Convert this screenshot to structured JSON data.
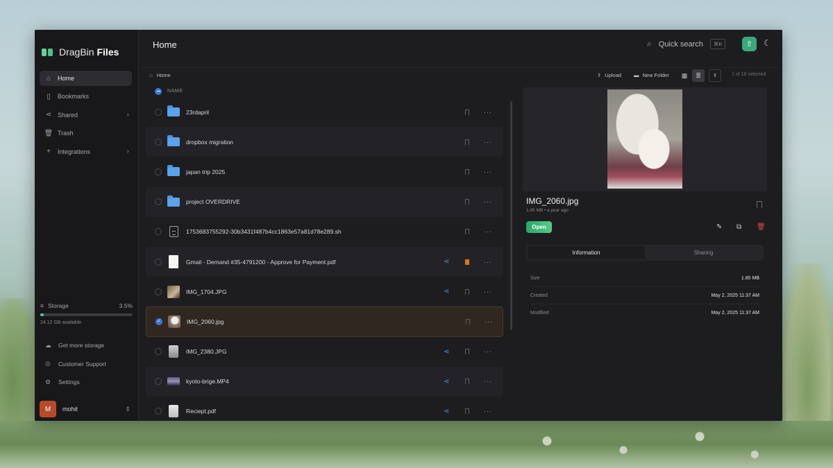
{
  "brand": {
    "name_light": "DragBin",
    "name_bold": "Files"
  },
  "sidebar": {
    "items": [
      {
        "label": "Home",
        "icon": "home-icon"
      },
      {
        "label": "Bookmarks",
        "icon": "bookmark-icon"
      },
      {
        "label": "Shared",
        "icon": "share-icon"
      },
      {
        "label": "Trash",
        "icon": "trash-icon"
      },
      {
        "label": "Integrations",
        "icon": "plus-icon"
      }
    ],
    "storage": {
      "label": "Storage",
      "percent_text": "3.5%",
      "percent": 3.5,
      "available": "24.12 GB available"
    },
    "links": [
      {
        "label": "Get more storage",
        "icon": "cloud-icon"
      },
      {
        "label": "Customer Support",
        "icon": "support-icon"
      },
      {
        "label": "Settings",
        "icon": "gear-icon"
      }
    ],
    "user": {
      "initial": "M",
      "name": "mohit"
    }
  },
  "header": {
    "title": "Home",
    "search_label": "Quick search",
    "search_shortcut": "⌘K"
  },
  "toolbar": {
    "breadcrumb": "Home",
    "upload": "Upload",
    "new_folder": "New Folder",
    "selection": "1 of 18 selected"
  },
  "list": {
    "column": "NAME",
    "rows": [
      {
        "name": "23rdapril",
        "type": "folder",
        "shared": false,
        "bookmarked": false
      },
      {
        "name": "dropbox migration",
        "type": "folder",
        "shared": false,
        "bookmarked": false
      },
      {
        "name": "japan trip 2025",
        "type": "folder",
        "shared": false,
        "bookmarked": false
      },
      {
        "name": "project OVERDRIVE",
        "type": "folder",
        "shared": false,
        "bookmarked": false
      },
      {
        "name": "1753683755292-30b3431f487b4cc1863e57a81d78e289.sh",
        "type": "doc",
        "shared": false,
        "bookmarked": false
      },
      {
        "name": "Gmail - Demand #35-4791200 - Approve for Payment.pdf",
        "type": "pdf",
        "shared": true,
        "bookmarked": true
      },
      {
        "name": "IMG_1704.JPG",
        "type": "image",
        "shared": true,
        "bookmarked": false
      },
      {
        "name": "IMG_2060.jpg",
        "type": "image",
        "shared": false,
        "bookmarked": false,
        "selected": true
      },
      {
        "name": "IMG_2380.JPG",
        "type": "image",
        "shared": true,
        "bookmarked": false
      },
      {
        "name": "kyoto-brige.MP4",
        "type": "video",
        "shared": true,
        "bookmarked": false
      },
      {
        "name": "Reciept.pdf",
        "type": "pdf",
        "shared": true,
        "bookmarked": false
      }
    ]
  },
  "preview": {
    "name": "IMG_2060.jpg",
    "meta": "1.85 MB • a year ago",
    "open": "Open",
    "tabs": [
      "Information",
      "Sharing"
    ],
    "info": [
      {
        "label": "Size",
        "value": "1.85 MB"
      },
      {
        "label": "Created",
        "value": "May 2, 2025 11:37 AM"
      },
      {
        "label": "Modified",
        "value": "May 2, 2025 11:37 AM"
      }
    ]
  },
  "colors": {
    "accent": "#3a78d6",
    "brand": "#52c98a",
    "danger": "#e04848",
    "bookmark": "#e0701f"
  }
}
